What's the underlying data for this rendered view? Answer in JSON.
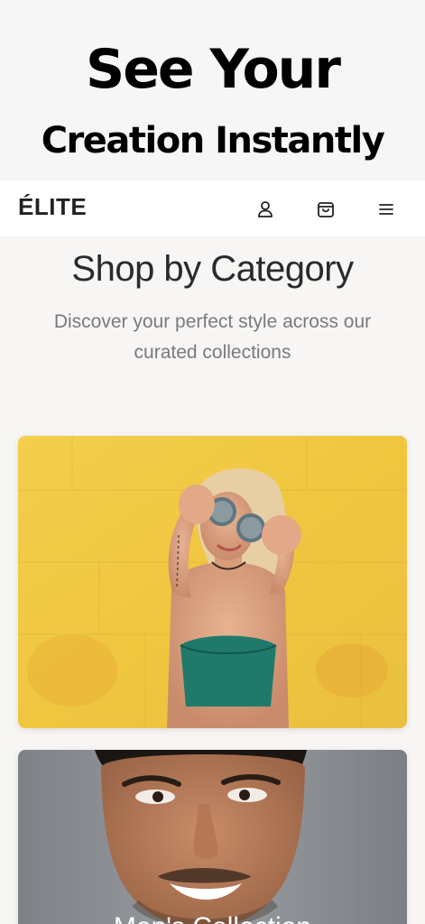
{
  "promo": {
    "line1": "See Your",
    "line2": "Creation Instantly"
  },
  "navbar": {
    "brand": "ÉLITE",
    "icons": [
      "account-icon",
      "shopping-bag-icon",
      "menu-icon"
    ]
  },
  "main": {
    "title": "Shop by Category",
    "subtitle": "Discover your perfect style across our curated collections",
    "categories": [
      {
        "label": ""
      },
      {
        "label": "Men's Collection"
      }
    ]
  },
  "colors": {
    "promo_bg": "#f6f6f6",
    "navbar_bg": "#ffffff",
    "main_bg": "#f7f6f4",
    "women_card_bg": "#f0c84a",
    "men_card_bg": "#8c8f93"
  }
}
